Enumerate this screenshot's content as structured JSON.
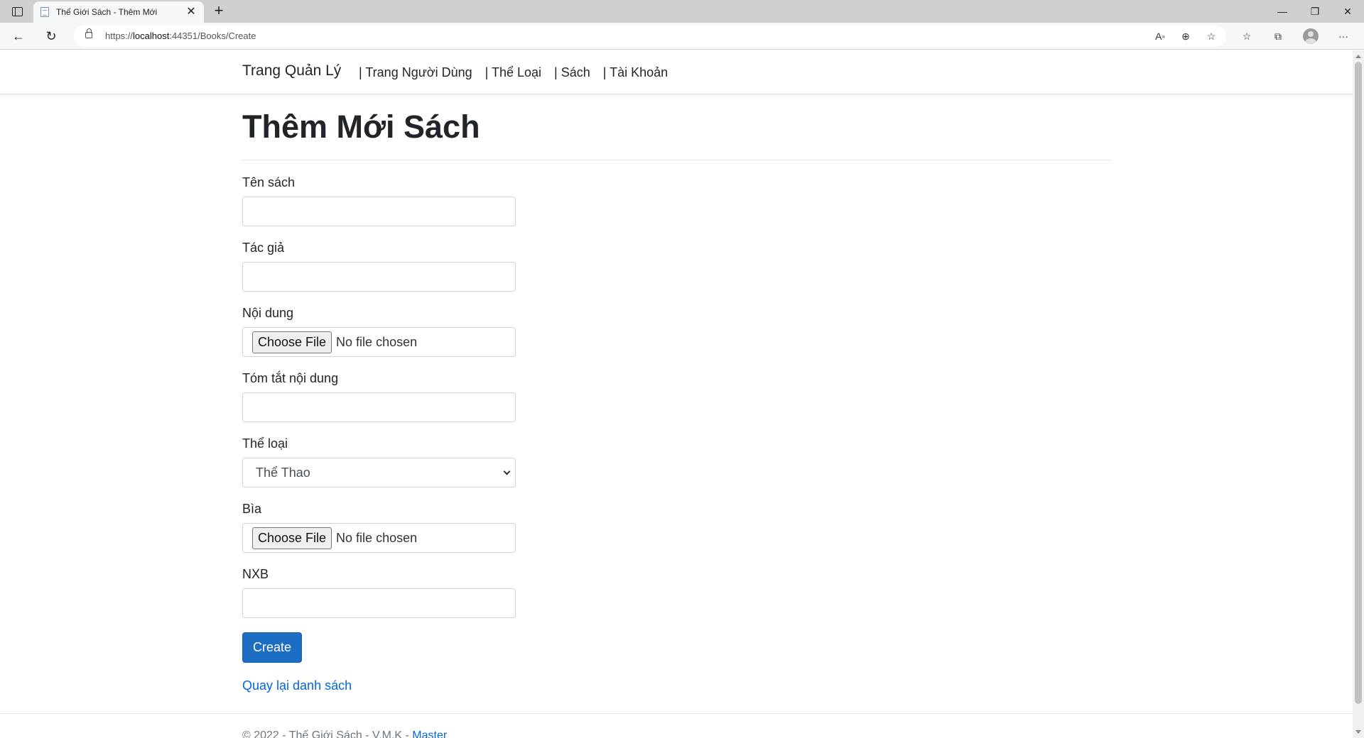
{
  "browser": {
    "tab_title": "Thế Giới Sách - Thêm Mới",
    "url_prefix": "https://",
    "url_host": "localhost",
    "url_rest": ":44351/Books/Create"
  },
  "nav": {
    "brand": "Trang Quản Lý",
    "links": [
      "| Trang Người Dùng",
      "| Thể Loại",
      "| Sách",
      "| Tài Khoản"
    ]
  },
  "page": {
    "title": "Thêm Mới Sách"
  },
  "form": {
    "ten_sach_label": "Tên sách",
    "tac_gia_label": "Tác giả",
    "noi_dung_label": "Nội dung",
    "tom_tat_label": "Tóm tắt nội dung",
    "the_loai_label": "Thể loại",
    "the_loai_value": "Thể Thao",
    "bia_label": "Bìa",
    "nxb_label": "NXB",
    "file_button": "Choose File",
    "file_none": "No file chosen",
    "submit": "Create",
    "back": "Quay lại danh sách"
  },
  "footer": {
    "text": "© 2022 - Thế Giới Sách - V.M.K -",
    "link": "Master"
  },
  "colors": {
    "primary": "#1b6ec2",
    "link": "#0366d6"
  }
}
